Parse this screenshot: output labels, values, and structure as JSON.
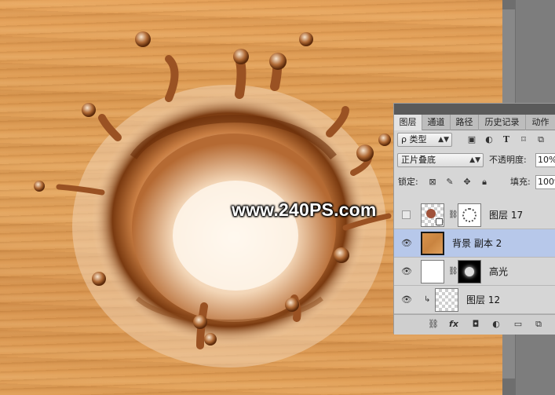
{
  "watermark": "www.240PS.com",
  "layers_panel": {
    "tabs": [
      {
        "label": "图层",
        "active": true
      },
      {
        "label": "通道",
        "active": false
      },
      {
        "label": "路径",
        "active": false
      },
      {
        "label": "历史记录",
        "active": false
      },
      {
        "label": "动作",
        "active": false
      }
    ],
    "filter": {
      "label": "ρ 类型",
      "icons": [
        "image-filter-icon",
        "adjustment-filter-icon",
        "type-filter-icon",
        "shape-filter-icon",
        "smart-object-filter-icon"
      ]
    },
    "blend_mode": "正片叠底",
    "opacity_label": "不透明度:",
    "opacity_value": "10%",
    "lock_label": "锁定:",
    "fill_label": "填充:",
    "fill_value": "100%",
    "layers": [
      {
        "name": "图层 17",
        "visible": false,
        "selected": false
      },
      {
        "name": "背景 副本 2",
        "visible": true,
        "selected": true
      },
      {
        "name": "高光",
        "visible": true,
        "selected": false
      },
      {
        "name": "图层 12",
        "visible": true,
        "selected": false
      }
    ],
    "footer_icons": [
      "link-layers-icon",
      "fx-icon",
      "add-mask-icon",
      "adjustment-layer-icon",
      "new-group-icon",
      "new-layer-icon"
    ]
  }
}
